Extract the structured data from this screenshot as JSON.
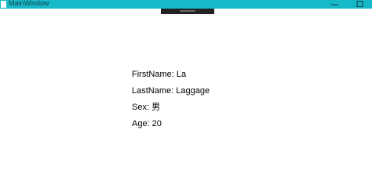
{
  "window": {
    "title": "MainWindow",
    "accent_color": "#17b8c8",
    "icons": {
      "app": "window-app-icon",
      "minimize": "minimize-icon",
      "maximize": "maximize-icon"
    }
  },
  "fields": [
    {
      "label": "FirstName: La"
    },
    {
      "label": "LastName: Laggage"
    },
    {
      "label": "Sex: 男"
    },
    {
      "label": "Age: 20"
    }
  ]
}
